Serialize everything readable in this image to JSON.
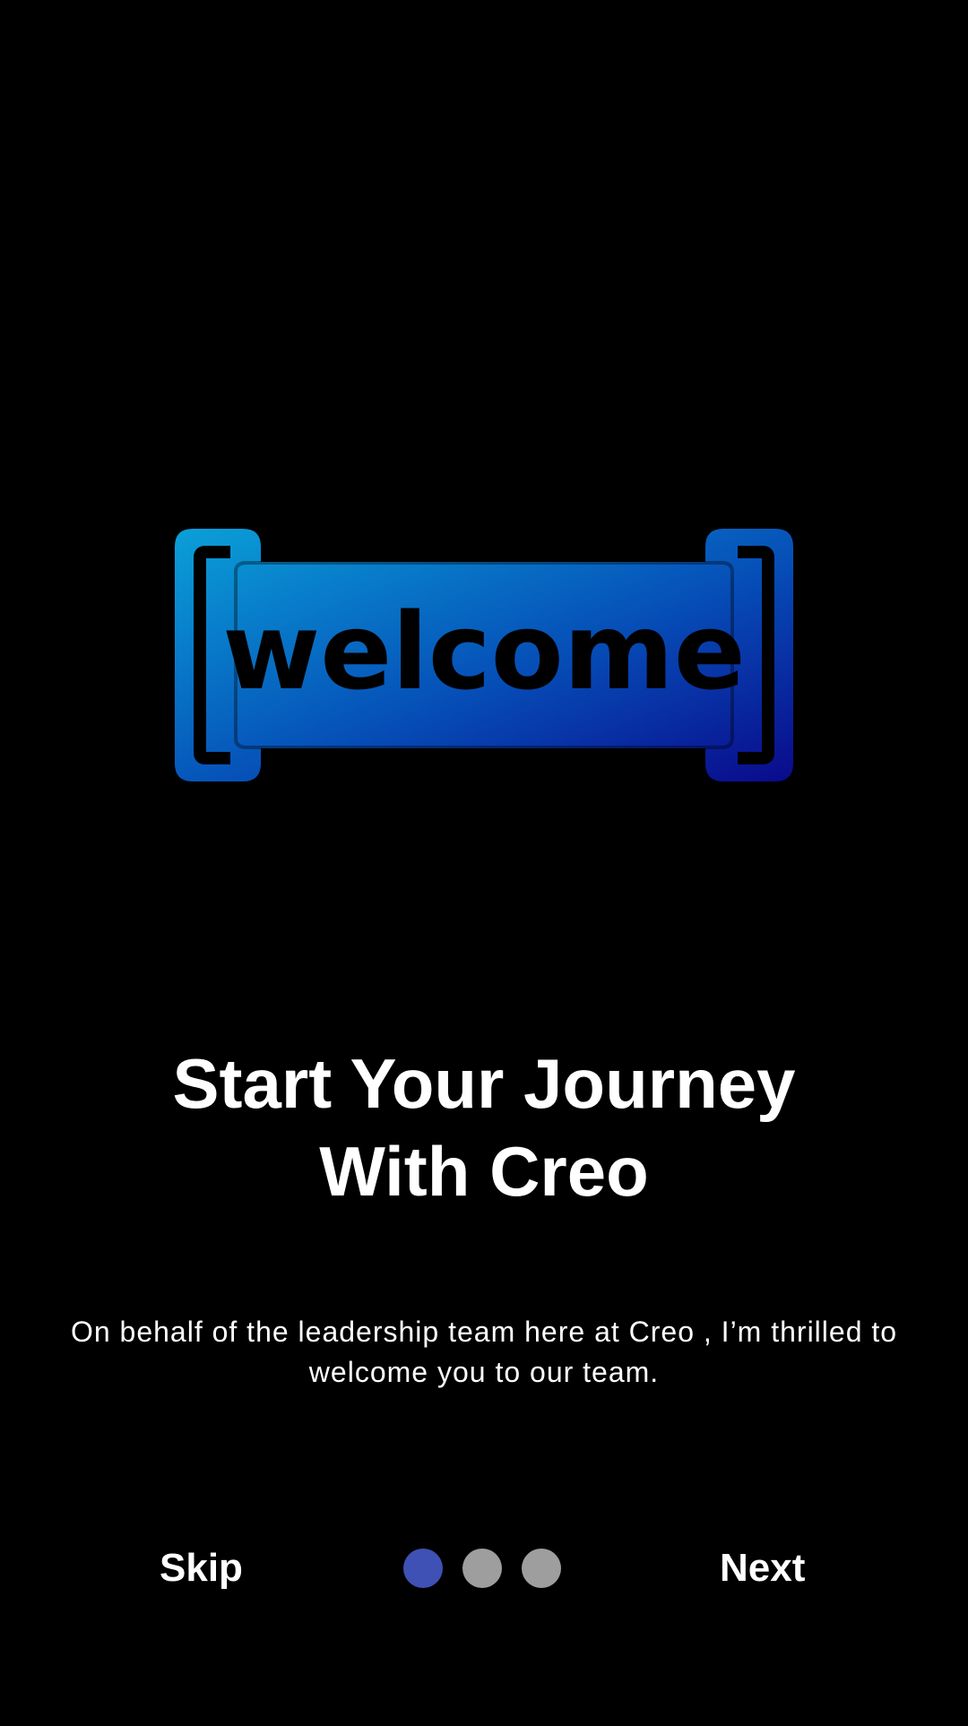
{
  "logo": {
    "text": "welcome",
    "icon": "welcome-banner-logo",
    "gradient_start": "#0aa0d8",
    "gradient_end": "#0a0a8c"
  },
  "title": {
    "line1": "Start Your Journey",
    "line2": "With Creo"
  },
  "subtitle": "On behalf of the leadership team here at Creo , I’m thrilled to welcome you to our team.",
  "footer": {
    "skip_label": "Skip",
    "next_label": "Next",
    "pager": {
      "total": 3,
      "active_index": 0,
      "active_color": "#3f51b5",
      "inactive_color": "#9e9e9e"
    }
  }
}
